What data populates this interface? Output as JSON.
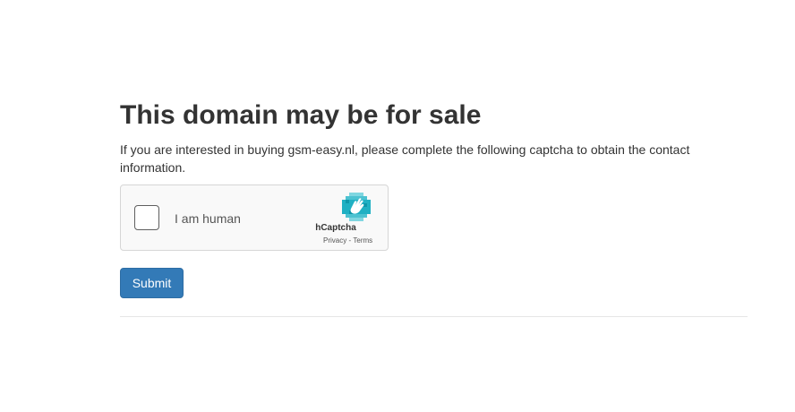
{
  "page": {
    "title": "This domain may be for sale",
    "description": "If you are interested in buying gsm-easy.nl, please complete the following captcha to obtain the contact information."
  },
  "captcha": {
    "label": "I am human",
    "brand": "hCaptcha",
    "privacy_link": "Privacy",
    "separator": "-",
    "terms_link": "Terms",
    "checked": false,
    "logo_icon": "hcaptcha-hand-logo"
  },
  "form": {
    "submit_label": "Submit"
  },
  "colors": {
    "primary_button": "#337ab7",
    "text": "#333333",
    "captcha_background": "#f9f9f9",
    "hcaptcha_teal": "#0fa5b8"
  }
}
